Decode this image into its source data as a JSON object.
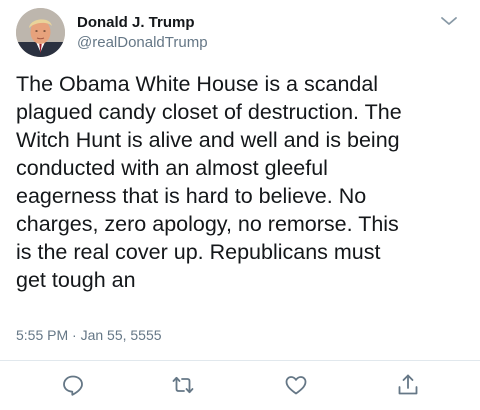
{
  "tweet": {
    "author_name": "Donald J. Trump",
    "author_handle": "@realDonaldTrump",
    "text": "The Obama White House is a scandal\nplagued candy closet of destruction. The\nWitch Hunt is alive and well and is being\nconducted with an almost gleeful\neagerness that is hard to believe. No\ncharges, zero apology, no remorse. This\nis the real cover up. Republicans must\nget tough an",
    "timestamp": "5:55 PM · Jan 55, 5555"
  },
  "icons": {
    "menu": "chevron-down-icon",
    "reply": "reply-icon",
    "retweet": "retweet-icon",
    "like": "heart-icon",
    "share": "share-icon"
  },
  "colors": {
    "text": "#14171a",
    "secondary": "#657786",
    "divider": "#e1e8ed"
  }
}
